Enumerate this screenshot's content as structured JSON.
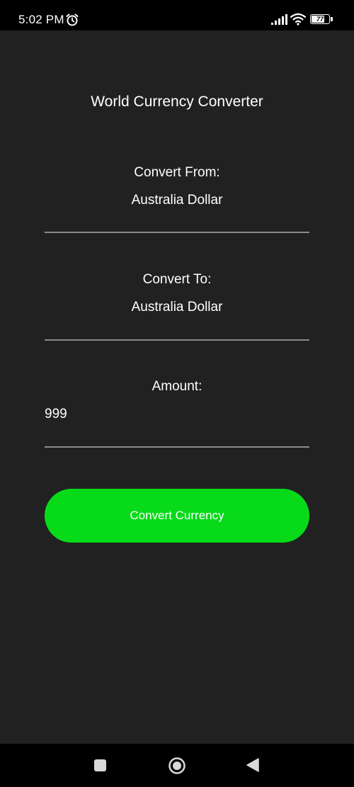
{
  "status_bar": {
    "time": "5:02 PM",
    "battery_level": "77",
    "battery_fraction": 0.77,
    "icons": [
      "alarm-icon",
      "signal-icon",
      "wifi-icon",
      "battery-icon"
    ]
  },
  "app": {
    "title": "World Currency Converter",
    "convert_from": {
      "label": "Convert From:",
      "value": "Australia Dollar"
    },
    "convert_to": {
      "label": "Convert To:",
      "value": "Australia Dollar"
    },
    "amount": {
      "label": "Amount:",
      "value": "999"
    },
    "convert_button_label": "Convert Currency"
  },
  "nav_bar": {
    "icons": [
      "recents-icon",
      "home-icon",
      "back-icon"
    ]
  },
  "colors": {
    "background": "#212121",
    "accent": "#07db19",
    "divider": "#8a8a8a",
    "text": "#ffffff"
  }
}
